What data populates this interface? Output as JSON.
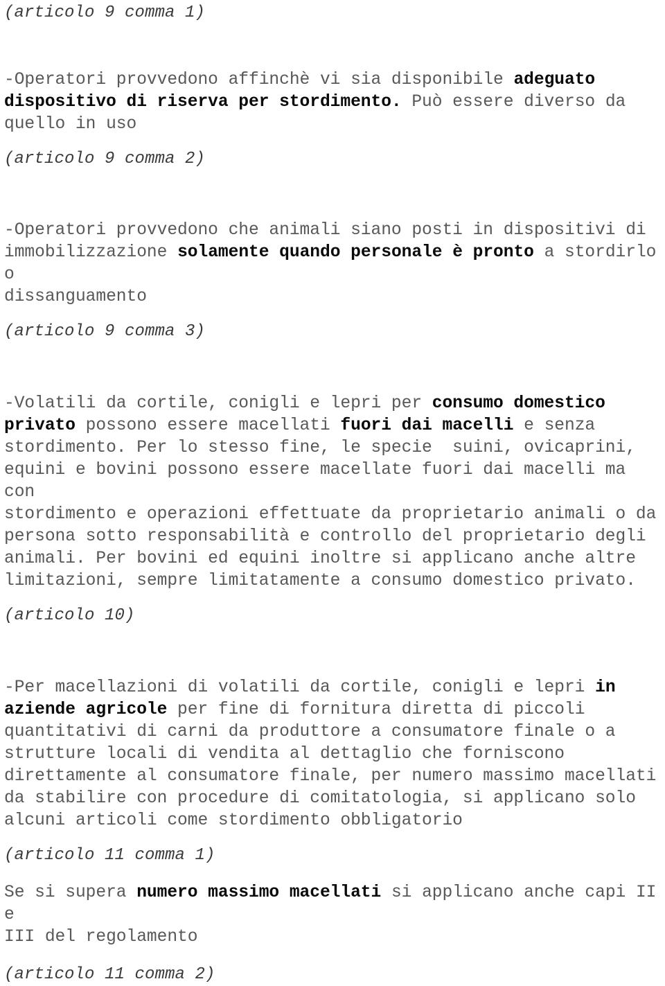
{
  "document": {
    "language": "it",
    "text_color": "#585858",
    "bold_color": "#0a0a0a",
    "heading_color": "#3b3b3b",
    "background": "#ffffff",
    "blocks": [
      {
        "id": "ref-9-1",
        "kind": "article-ref",
        "text": "(articolo 9 comma 1)"
      },
      {
        "id": "para-9-1",
        "kind": "paragraph",
        "lines": [
          [
            {
              "t": "-Operatori provvedono affinchè vi sia disponibile ",
              "b": false
            },
            {
              "t": "adeguato",
              "b": true
            }
          ],
          [
            {
              "t": "dispositivo di riserva per stordimento.",
              "b": true
            },
            {
              "t": " Può essere diverso da",
              "b": false
            }
          ],
          [
            {
              "t": "quello in uso",
              "b": false
            }
          ]
        ]
      },
      {
        "id": "ref-9-2",
        "kind": "article-ref",
        "text": "(articolo 9 comma 2)"
      },
      {
        "id": "para-9-2",
        "kind": "paragraph",
        "lines": [
          [
            {
              "t": "-Operatori provvedono che animali siano posti in dispositivi di",
              "b": false
            }
          ],
          [
            {
              "t": "immobilizzazione ",
              "b": false
            },
            {
              "t": "solamente quando personale è pronto",
              "b": true
            },
            {
              "t": " a stordirlo o",
              "b": false
            }
          ],
          [
            {
              "t": "dissanguamento",
              "b": false
            }
          ]
        ]
      },
      {
        "id": "ref-9-3",
        "kind": "article-ref",
        "text": "(articolo 9 comma 3)"
      },
      {
        "id": "para-9-3",
        "kind": "paragraph",
        "lines": [
          [
            {
              "t": "-Volatili da cortile, conigli e lepri per ",
              "b": false
            },
            {
              "t": "consumo domestico",
              "b": true
            }
          ],
          [
            {
              "t": "privato",
              "b": true
            },
            {
              "t": " possono essere macellati ",
              "b": false
            },
            {
              "t": "fuori dai macelli",
              "b": true
            },
            {
              "t": " e senza",
              "b": false
            }
          ],
          [
            {
              "t": "stordimento. Per lo stesso fine, le specie  suini, ovicaprini,",
              "b": false
            }
          ],
          [
            {
              "t": "equini e bovini possono essere macellate fuori dai macelli ma con",
              "b": false
            }
          ],
          [
            {
              "t": "stordimento e operazioni effettuate da proprietario animali o da",
              "b": false
            }
          ],
          [
            {
              "t": "persona sotto responsabilità e controllo del proprietario degli",
              "b": false
            }
          ],
          [
            {
              "t": "animali. Per bovini ed equini inoltre si applicano anche altre",
              "b": false
            }
          ],
          [
            {
              "t": "limitazioni, sempre limitatamente a consumo domestico privato.",
              "b": false
            }
          ]
        ]
      },
      {
        "id": "ref-10",
        "kind": "article-ref",
        "text": "(articolo 10)"
      },
      {
        "id": "para-10",
        "kind": "paragraph",
        "lines": [
          [
            {
              "t": "-Per macellazioni di volatili da cortile, conigli e lepri ",
              "b": false
            },
            {
              "t": "in",
              "b": true
            }
          ],
          [
            {
              "t": "aziende agricole",
              "b": true
            },
            {
              "t": " per fine di fornitura diretta di piccoli",
              "b": false
            }
          ],
          [
            {
              "t": "quantitativi di carni da produttore a consumatore finale o a",
              "b": false
            }
          ],
          [
            {
              "t": "strutture locali di vendita al dettaglio che forniscono",
              "b": false
            }
          ],
          [
            {
              "t": "direttamente al consumatore finale, per numero massimo macellati",
              "b": false
            }
          ],
          [
            {
              "t": "da stabilire con procedure di comitatologia, si applicano solo",
              "b": false
            }
          ],
          [
            {
              "t": "alcuni articoli come stordimento obbligatorio",
              "b": false
            }
          ]
        ]
      },
      {
        "id": "ref-11-1",
        "kind": "article-ref",
        "text": "(articolo 11 comma 1)"
      },
      {
        "id": "para-11-1",
        "kind": "paragraph",
        "lines": [
          [
            {
              "t": "Se si supera ",
              "b": false
            },
            {
              "t": "numero massimo macellati",
              "b": true
            },
            {
              "t": " si applicano anche capi II e",
              "b": false
            }
          ],
          [
            {
              "t": "III del regolamento",
              "b": false
            }
          ]
        ]
      },
      {
        "id": "ref-11-2",
        "kind": "article-ref",
        "text": "(articolo 11 comma 2)"
      }
    ]
  }
}
